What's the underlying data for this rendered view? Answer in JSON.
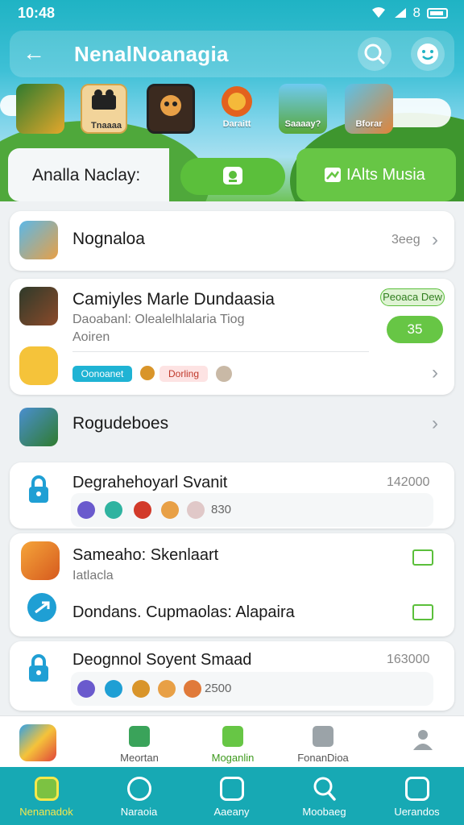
{
  "status": {
    "time": "10:48",
    "indicator": "8"
  },
  "appbar": {
    "title": "NenalNoanagia"
  },
  "games": [
    {
      "label": ""
    },
    {
      "label": "Tnaaaa"
    },
    {
      "label": ""
    },
    {
      "label": "Daraitt"
    },
    {
      "label": "Saaaay?"
    },
    {
      "label": "Bforar"
    }
  ],
  "filter": {
    "label": "Analla Naclay:",
    "button_right": "IAlts Musia"
  },
  "cards": {
    "c1": {
      "name": "Nognaloa",
      "meta": "3eeg"
    },
    "c2": {
      "name": "Camiyles Marle Dundaasia",
      "sub1": "Daoabanl: Olealelhlalaria Tiog",
      "sub2": "Aoiren",
      "badge": "Peoaca Dew",
      "count": "35",
      "tag1": "Oonoanet",
      "tag2": "Dorling"
    },
    "c3": {
      "name": "Rogudeboes"
    },
    "c4": {
      "name": "Degrahehoyarl Svanit",
      "meta": "142000",
      "mini_value": "830"
    },
    "c5": {
      "name1": "Sameaho: Skenlaart",
      "sub1": "Iatlacla",
      "name2": "Dondans. Cupmaolas: Alapaira"
    },
    "c6": {
      "name": "Deognnol Soyent Smaad",
      "meta": "163000",
      "mini_value": "2500"
    }
  },
  "secnav": [
    "",
    "Meortan",
    "Moganlin",
    "FonanDioa"
  ],
  "bottomnav": [
    "Nenanadok",
    "Naraoia",
    "Aaeany",
    "Moobaeg",
    "Uerandos"
  ],
  "colors": {
    "accent_green": "#5bbf3b",
    "teal": "#17a9b4",
    "active_label": "#f7e84b"
  }
}
